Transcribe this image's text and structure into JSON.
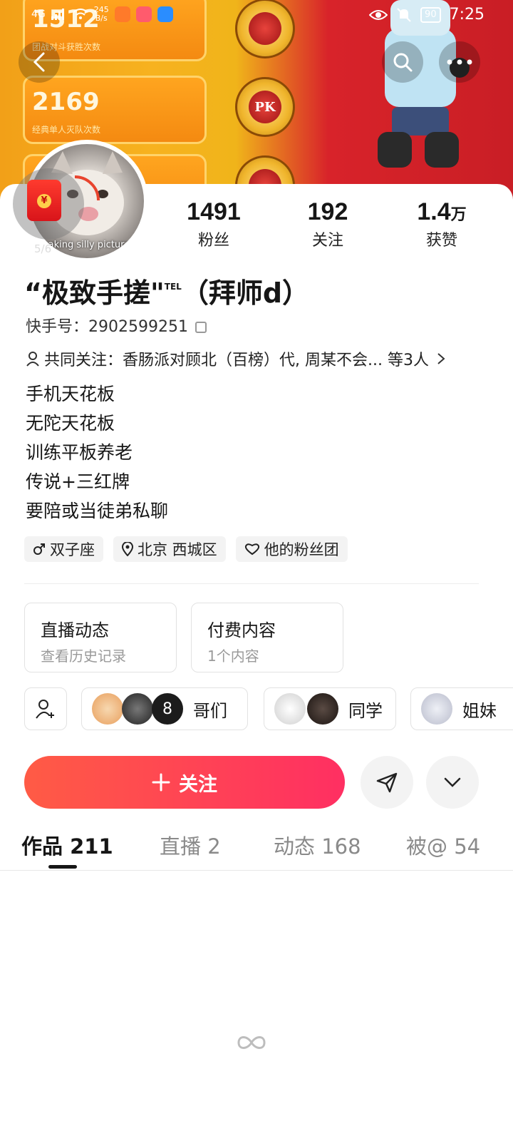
{
  "cover": {
    "card_values": [
      "1512",
      "2169",
      ""
    ],
    "card_captions": [
      "团战对斗获胜次数",
      "经典单人灭队次数",
      ""
    ],
    "badge_text": [
      "",
      "PK",
      ""
    ]
  },
  "status_bar": {
    "network": "4G",
    "speed_value": "245",
    "speed_unit": "B/s",
    "battery": "90",
    "time": "7:25"
  },
  "header": {
    "back_icon": "chevron-left-icon",
    "search_icon": "search-icon",
    "more_icon": "more-horizontal-icon"
  },
  "profile": {
    "avatar_caption": "making silly pictures",
    "red_packet_count": "5/6",
    "stats": [
      {
        "value": "1491",
        "unit": "",
        "label": "粉丝"
      },
      {
        "value": "192",
        "unit": "",
        "label": "关注"
      },
      {
        "value": "1.4",
        "unit": "万",
        "label": "获赞"
      }
    ],
    "nickname": "“极致手搓\"",
    "nickname_sup": "TEL",
    "nickname_suffix": "（拜师d）",
    "ks_id_label": "快手号：",
    "ks_id": "2902599251",
    "mutual_label": "共同关注：",
    "mutual_text": "香肠派对顾北（百榜）代, 周某不会... 等3人",
    "bio_lines": [
      "手机天花板",
      "无陀天花板",
      "训练平板养老",
      "传说+三红牌",
      "要陪或当徒弟私聊"
    ],
    "tags": [
      "双子座",
      "北京 西城区",
      "他的粉丝团"
    ]
  },
  "cards": [
    {
      "title": "直播动态",
      "subtitle": "查看历史记录"
    },
    {
      "title": "付费内容",
      "subtitle": "1个内容"
    }
  ],
  "groups": [
    {
      "name": "哥们",
      "extra": "8"
    },
    {
      "name": "同学",
      "extra": ""
    },
    {
      "name": "姐妹",
      "extra": ""
    }
  ],
  "actions": {
    "follow_label": "关注"
  },
  "tabs": [
    "作品 211",
    "直播 2",
    "动态 168",
    "被@ 54"
  ],
  "colors": {
    "accent_start": "#ff5b45",
    "accent_end": "#ff2f62"
  }
}
